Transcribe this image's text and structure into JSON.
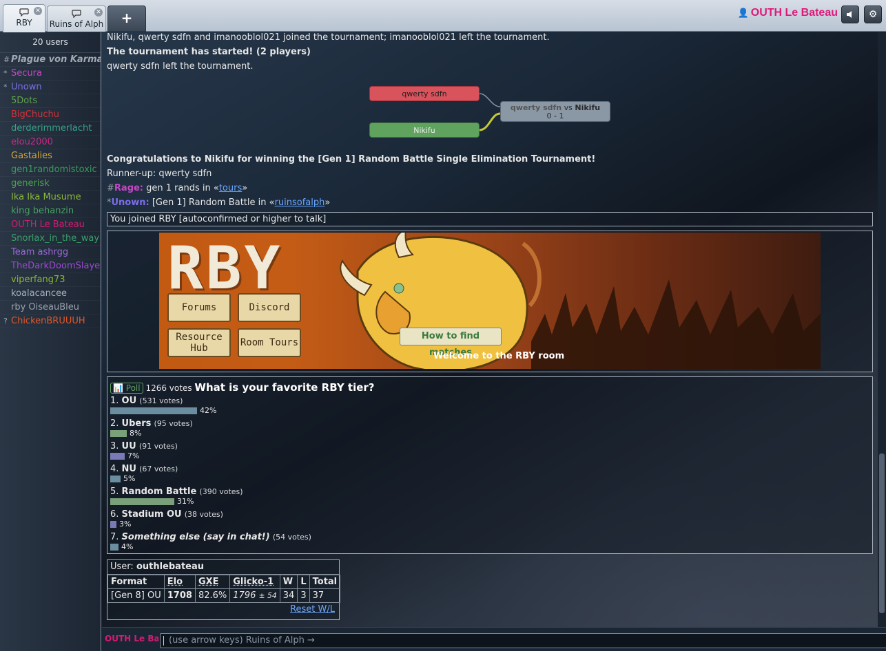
{
  "header": {
    "tabs": [
      {
        "label": "RBY",
        "active": true
      },
      {
        "label": "Ruins of Alph",
        "active": false
      }
    ],
    "add_tab_label": "+",
    "username": "OUTH Le Bateau"
  },
  "userlist": {
    "count_label": "20 users",
    "users": [
      {
        "rank": "#",
        "name": "Plague von Karma",
        "color": "#a0a8b4",
        "away": true
      },
      {
        "rank": "*",
        "name": "Secura",
        "color": "#c746c7"
      },
      {
        "rank": "*",
        "name": "Unown",
        "color": "#7c6ee8"
      },
      {
        "rank": "",
        "name": "5Dots",
        "color": "#5fa34a"
      },
      {
        "rank": "",
        "name": "BigChuchu",
        "color": "#d2303a"
      },
      {
        "rank": "",
        "name": "derderimmerlacht",
        "color": "#3aa08a"
      },
      {
        "rank": "",
        "name": "elou2000",
        "color": "#c72a86"
      },
      {
        "rank": "",
        "name": "Gastalies",
        "color": "#d6a83a"
      },
      {
        "rank": "",
        "name": "gen1randomistoxic",
        "color": "#3a9a5a"
      },
      {
        "rank": "",
        "name": "generisk",
        "color": "#4aa04a"
      },
      {
        "rank": "",
        "name": "Ika Ika Musume",
        "color": "#8ab83a"
      },
      {
        "rank": "",
        "name": "king behanzin",
        "color": "#4aa060"
      },
      {
        "rank": "",
        "name": "OUTH Le Bateau",
        "color": "#d91a75"
      },
      {
        "rank": "",
        "name": "Snorlax_in_the_way",
        "color": "#3aa06a"
      },
      {
        "rank": "",
        "name": "Team ashrgg",
        "color": "#9a6ad8"
      },
      {
        "rank": "",
        "name": "TheDarkDoomSlayer",
        "color": "#9a4ad0"
      },
      {
        "rank": "",
        "name": "viperfang73",
        "color": "#8ab830"
      },
      {
        "rank": "",
        "name": "koalacancee",
        "color": "#a8aeb6"
      },
      {
        "rank": "",
        "name": "rby OiseauBleu",
        "color": "#9aa2ac"
      },
      {
        "rank": "?",
        "name": "ChickenBRUUUH",
        "color": "#e0582a"
      }
    ]
  },
  "chat": {
    "line1": "Nikifu, qwerty sdfn and imanooblol021 joined the tournament; imanooblol021 left the tournament.",
    "line2": "The tournament has started! (2 players)",
    "line3": "qwerty sdfn left the tournament.",
    "bracket": {
      "player1": "qwerty sdfn",
      "player2": "Nikifu",
      "final_loser": "qwerty sdfn",
      "final_vs": "vs",
      "final_winner": "Nikifu",
      "final_score": "0 - 1"
    },
    "congrats": "Congratulations to Nikifu for winning the [Gen 1] Random Battle Single Elimination Tournament!",
    "runner_up": "Runner-up: qwerty sdfn",
    "rage": {
      "rank": "#",
      "name": "Rage:",
      "text_before": "gen 1 rands in «",
      "link": "tours",
      "text_after": "»"
    },
    "unown": {
      "rank": "*",
      "name": "Unown:",
      "text_before": "[Gen 1] Random Battle in «",
      "link": "ruinsofalph",
      "text_after": "»"
    },
    "joined": "You joined RBY [autoconfirmed or higher to talk]"
  },
  "banner": {
    "logo": "RBY",
    "buttons": [
      "Forums",
      "Discord",
      "Resource Hub",
      "Room Tours"
    ],
    "find_matches": "How to find matches",
    "welcome": "Welcome to the RBY room"
  },
  "poll": {
    "badge": "Poll",
    "votes": "1266 votes",
    "question": "What is your favorite RBY tier?",
    "options": [
      {
        "num": "1.",
        "name": "OU",
        "votes": "(531 votes)",
        "pct": "42%",
        "value": 42,
        "color": "#6a8ea0"
      },
      {
        "num": "2.",
        "name": "Ubers",
        "votes": "(95 votes)",
        "pct": "8%",
        "value": 8,
        "color": "#7aa07a"
      },
      {
        "num": "3.",
        "name": "UU",
        "votes": "(91 votes)",
        "pct": "7%",
        "value": 7,
        "color": "#7a7ab8"
      },
      {
        "num": "4.",
        "name": "NU",
        "votes": "(67 votes)",
        "pct": "5%",
        "value": 5,
        "color": "#6a8ea0"
      },
      {
        "num": "5.",
        "name": "Random Battle",
        "votes": "(390 votes)",
        "pct": "31%",
        "value": 31,
        "color": "#7aa07a"
      },
      {
        "num": "6.",
        "name": "Stadium OU",
        "votes": "(38 votes)",
        "pct": "3%",
        "value": 3,
        "color": "#7a7ab8"
      },
      {
        "num": "7.",
        "name": "Something else (say in chat!)",
        "votes": "(54 votes)",
        "pct": "4%",
        "value": 4,
        "color": "#6a8ea0"
      }
    ]
  },
  "rank": {
    "user_label": "User:",
    "user": "outhlebateau",
    "headers": [
      "Format",
      "Elo",
      "GXE",
      "Glicko-1",
      "W",
      "L",
      "Total"
    ],
    "row": {
      "format": "[Gen 8] OU",
      "elo": "1708",
      "gxe": "82.6%",
      "glicko": "1796",
      "glicko_dev": "± 54",
      "w": "34",
      "l": "3",
      "total": "37"
    },
    "reset": "Reset W/L"
  },
  "input": {
    "name": "OUTH Le Bateau",
    "placeholder": "(use arrow keys) Ruins of Alph →"
  }
}
